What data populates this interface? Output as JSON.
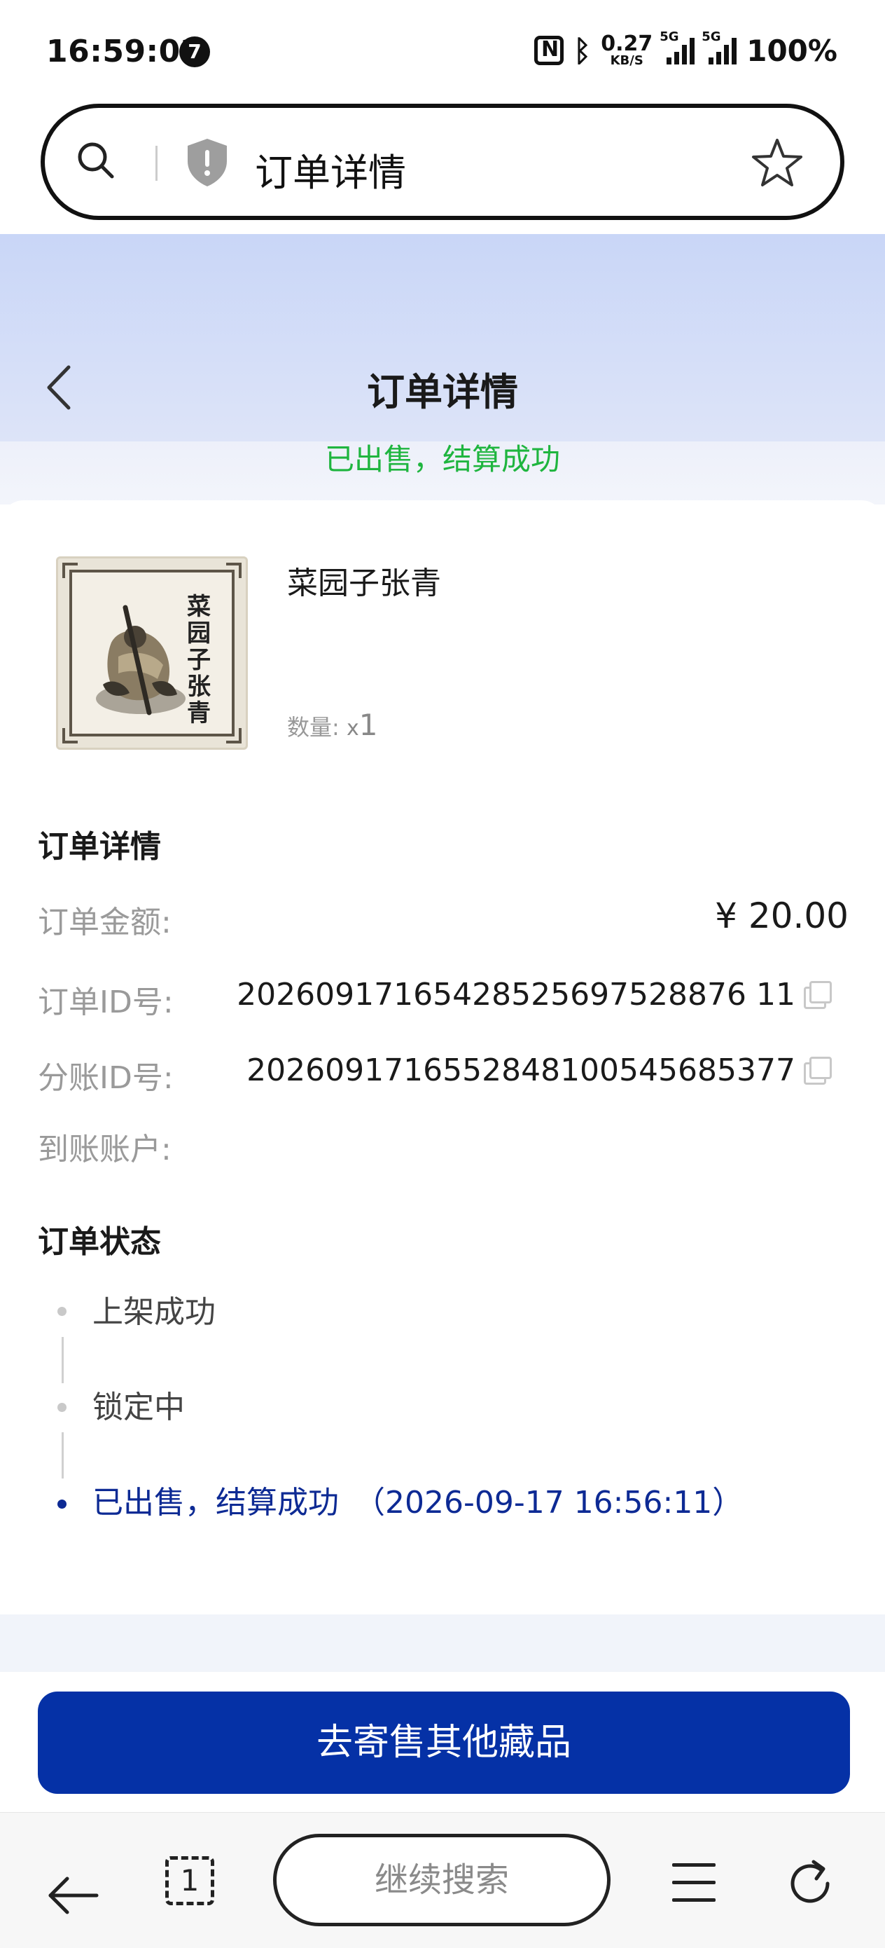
{
  "status_bar": {
    "time": "16:59:02",
    "notification_count": "7",
    "net_speed_value": "0.27",
    "net_speed_unit": "KB/S",
    "signal1_label": "5G",
    "signal2_label": "5G",
    "battery": "100%"
  },
  "browser": {
    "address_text": "订单详情",
    "icons": [
      "search-icon",
      "shield-icon",
      "star-icon"
    ]
  },
  "header": {
    "title": "订单详情",
    "status_banner": "已出售，结算成功",
    "status_color": "#1fb53f"
  },
  "product": {
    "name": "菜园子张青",
    "qty_label": "数量:",
    "qty_prefix": "x",
    "qty_value": "1",
    "thumb_calligraphy": "菜园子张青"
  },
  "order_details": {
    "section_title": "订单详情",
    "amount_label": "订单金额:",
    "amount_value": "¥ 20.00",
    "order_id_label": "订单ID号:",
    "order_id_value": "20260917165428525697528876 11",
    "split_id_label": "分账ID号:",
    "split_id_value": "2026091716552848100545685377",
    "account_label": "到账账户:",
    "account_value": ""
  },
  "order_status": {
    "section_title": "订单状态",
    "steps": [
      {
        "text": "上架成功",
        "active": false
      },
      {
        "text": "锁定中",
        "active": false
      },
      {
        "text": "已出售，结算成功　（2026-09-17 16:56:11）",
        "active": true
      }
    ],
    "active_color": "#0d2a94"
  },
  "actions": {
    "primary_button": "去寄售其他藏品",
    "primary_color": "#0531a6"
  },
  "bottom_nav": {
    "tabs_count": "1",
    "search_placeholder": "继续搜索",
    "icons": [
      "back-arrow-icon",
      "tabs-icon",
      "menu-icon",
      "refresh-icon"
    ]
  }
}
